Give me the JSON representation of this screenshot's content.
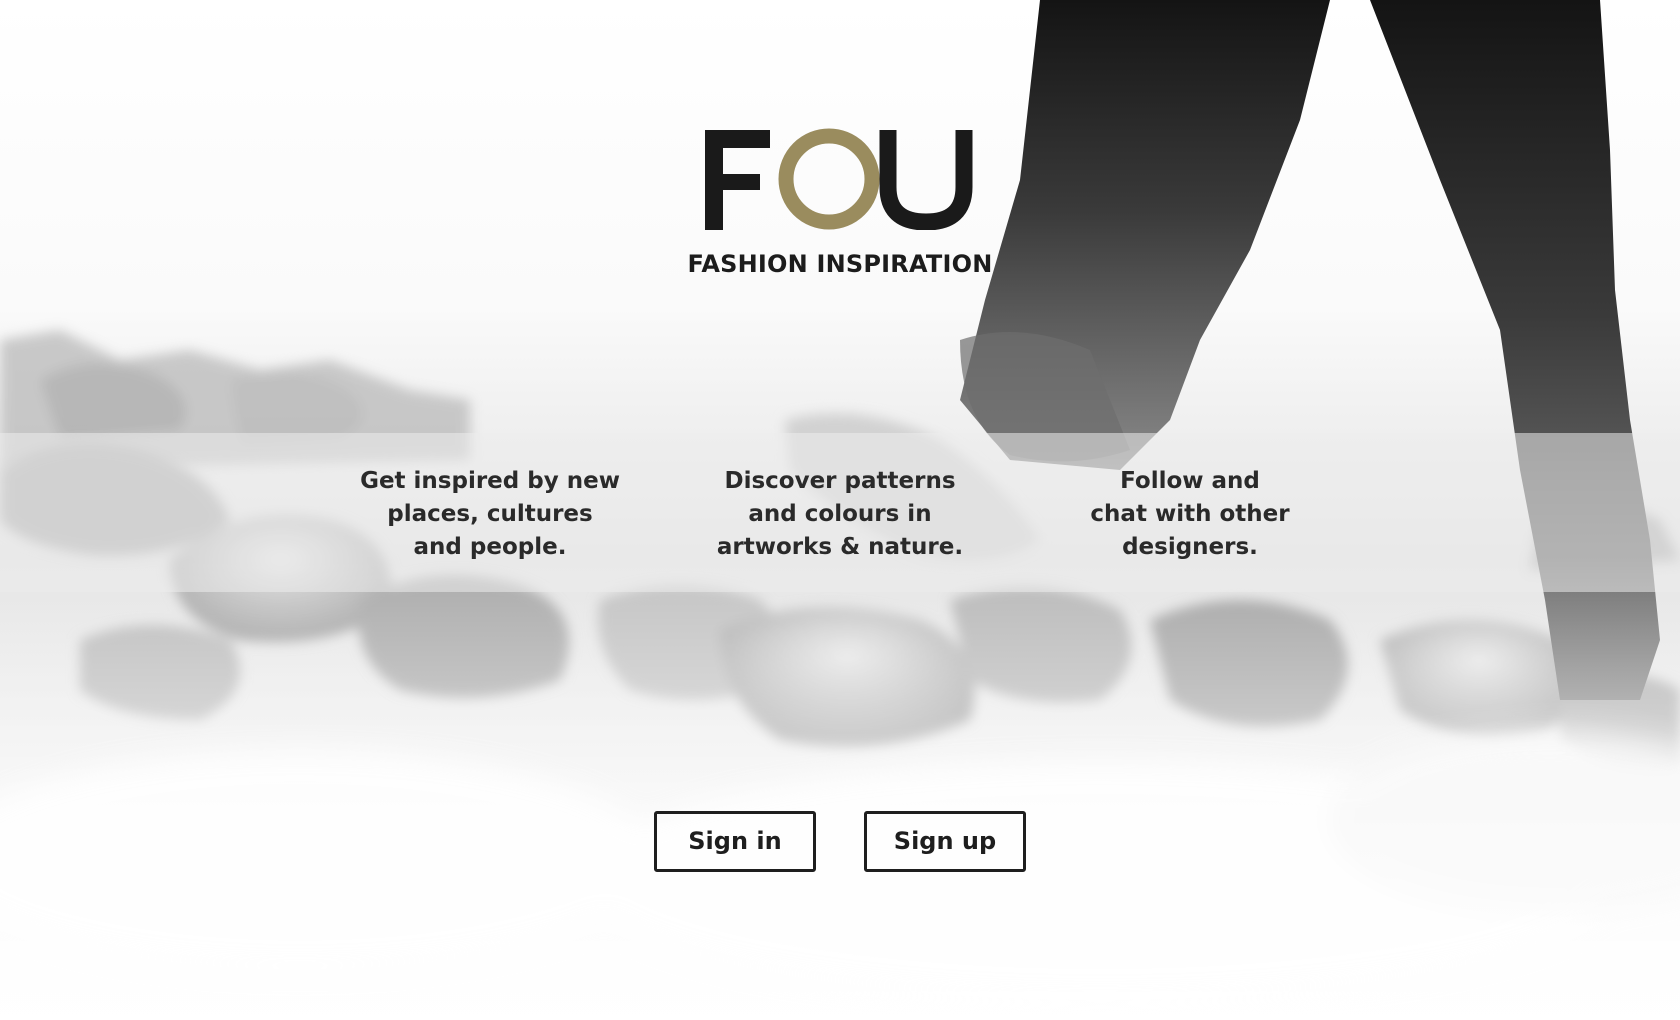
{
  "brand": {
    "logo_letters": [
      "F",
      "O",
      "U"
    ],
    "tagline": "FASHION INSPIRATION",
    "colors": {
      "dark": "#1a1a1a",
      "accent": "#9a8c5e"
    }
  },
  "features": [
    {
      "lines": [
        "Get inspired by new",
        "places, cultures",
        "and people."
      ]
    },
    {
      "lines": [
        "Discover patterns",
        "and colours in",
        "artworks & nature."
      ]
    },
    {
      "lines": [
        "Follow and",
        "chat with other",
        "designers."
      ]
    }
  ],
  "buttons": {
    "sign_in": "Sign in",
    "sign_up": "Sign up"
  }
}
